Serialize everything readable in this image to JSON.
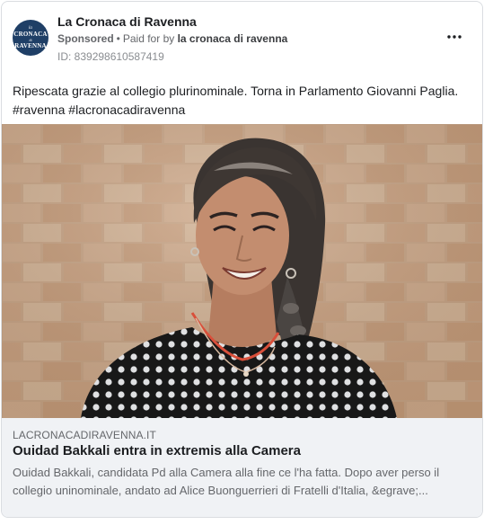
{
  "header": {
    "avatar_lines": [
      "la",
      "CRONACA",
      "di",
      "RAVENNA"
    ],
    "page_name": "La Cronaca di Ravenna",
    "sponsored_label": "Sponsored",
    "separator": "•",
    "paid_for_by_label": "Paid for by",
    "payer": "la cronaca di ravenna",
    "ad_id": "ID: 839298610587419",
    "more_icon": "more-horizontal-icon"
  },
  "post": {
    "text": "Ripescata grazie al collegio plurinominale. Torna in Parlamento Giovanni Paglia.",
    "hashtags": [
      "#ravenna",
      "#lacronacadiravenna"
    ]
  },
  "link_preview": {
    "domain": "LACRONACADIRAVENNA.IT",
    "title": "Ouidad Bakkali entra in extremis alla Camera",
    "description": "Ouidad Bakkali, candidata Pd alla Camera alla fine ce l'ha fatta. Dopo aver perso il collegio uninominale, andato ad Alice Buonguerrieri di Fratelli d'Italia, &egrave;..."
  },
  "colors": {
    "avatar_bg": "#1f3f66",
    "secondary_text": "#65676b",
    "link_box_bg": "#f0f2f5",
    "border": "#dadde1"
  }
}
